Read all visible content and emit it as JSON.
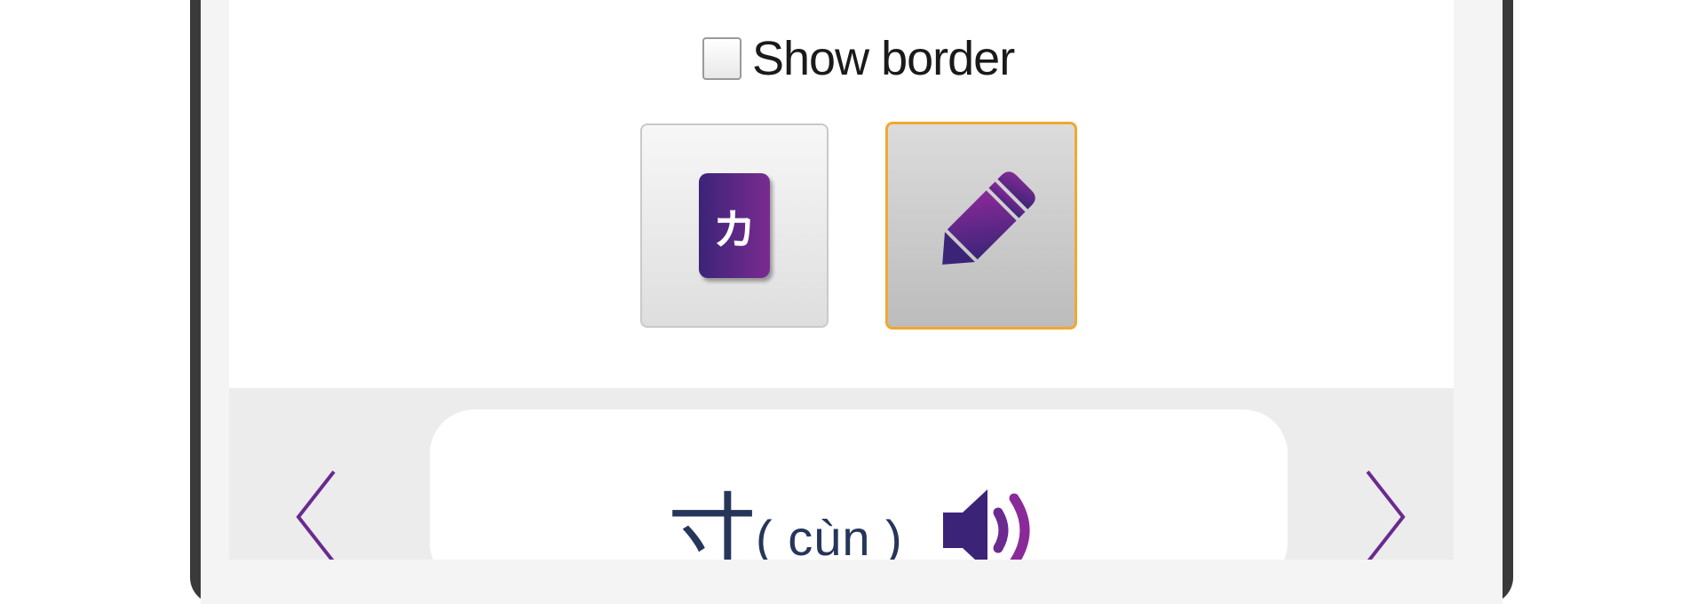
{
  "settings": {
    "show_border_label": "Show border",
    "show_border_checked": false
  },
  "modes": {
    "flashcard_icon": "card-icon",
    "flashcard_glyph": "カ",
    "write_icon": "pencil-icon",
    "selected": "write"
  },
  "character": {
    "hanzi": "寸",
    "pinyin": "( cùn )"
  },
  "nav": {
    "prev_icon": "chevron-left-icon",
    "next_icon": "chevron-right-icon",
    "sound_icon": "speaker-icon"
  },
  "colors": {
    "accent_purple": "#6a2a8f",
    "selected_border": "#f0a830",
    "text_navy": "#26365a"
  }
}
